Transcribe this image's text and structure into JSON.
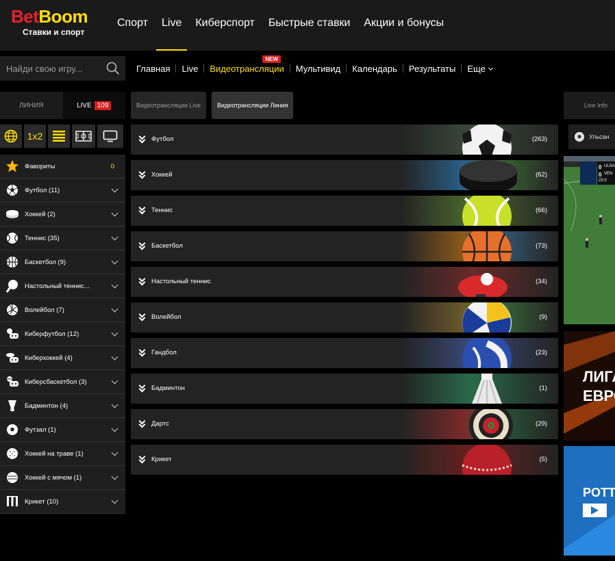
{
  "brand": {
    "name_part1": "Bet",
    "name_part2": "Boom",
    "tagline": "Ставки и спорт"
  },
  "main_nav": [
    {
      "label": "Спорт",
      "active": false
    },
    {
      "label": "Live",
      "active": true
    },
    {
      "label": "Киберспорт",
      "active": false
    },
    {
      "label": "Быстрые ставки",
      "active": false
    },
    {
      "label": "Акции и бонусы",
      "active": false
    }
  ],
  "search": {
    "placeholder": "Найди свою игру..."
  },
  "sub_nav": {
    "items": [
      "Главная",
      "Live",
      "Видеотрансляции",
      "Мультивид",
      "Календарь",
      "Результаты",
      "Еще"
    ],
    "highlighted": "Видеотрансляции",
    "new_badge": "NEW"
  },
  "left_tabs": {
    "line": "ЛИНИЯ",
    "live": "LIVE",
    "live_count": "109"
  },
  "filter_icons": [
    "globe-icon",
    "1x2",
    "list-icon",
    "field-icon",
    "monitor-icon"
  ],
  "favorites": {
    "label": "Фавориты",
    "count": "0"
  },
  "sports": [
    {
      "label": "Футбол (11)",
      "icon": "soccer-ball-icon"
    },
    {
      "label": "Хоккей (2)",
      "icon": "hockey-puck-icon"
    },
    {
      "label": "Теннис (35)",
      "icon": "tennis-ball-icon"
    },
    {
      "label": "Баскетбол (9)",
      "icon": "basketball-icon"
    },
    {
      "label": "Настольный теннис...",
      "icon": "table-tennis-icon"
    },
    {
      "label": "Волейбол (7)",
      "icon": "volleyball-icon"
    },
    {
      "label": "Киберфутбол (12)",
      "icon": "esports-soccer-icon"
    },
    {
      "label": "Киберхоккей (4)",
      "icon": "esports-hockey-icon"
    },
    {
      "label": "Киберсбаскетбол (3)",
      "icon": "esports-basketball-icon"
    },
    {
      "label": "Бадминтон (4)",
      "icon": "shuttlecock-icon"
    },
    {
      "label": "Футзал (1)",
      "icon": "futsal-ball-icon"
    },
    {
      "label": "Хоккей на траве (1)",
      "icon": "field-hockey-icon"
    },
    {
      "label": "Хоккей с мячом (1)",
      "icon": "bandy-ball-icon"
    },
    {
      "label": "Крикет (10)",
      "icon": "cricket-icon"
    }
  ],
  "video_tabs": {
    "live": "Видеотрансляции Live",
    "line": "Видеотрансляции Линия"
  },
  "categories": [
    {
      "name": "Футбол",
      "count": "(263)",
      "ball": "soccer-ball-icon",
      "paint": "#2a3a2a"
    },
    {
      "name": "Хоккей",
      "count": "(62)",
      "ball": "hockey-puck-icon",
      "paint": "#4a90c8"
    },
    {
      "name": "Теннис",
      "count": "(66)",
      "ball": "tennis-ball-icon",
      "paint": "#6b8f3a"
    },
    {
      "name": "Баскетбол",
      "count": "(73)",
      "ball": "basketball-icon",
      "paint": "#c87a2a"
    },
    {
      "name": "Настольный теннис",
      "count": "(34)",
      "ball": "table-tennis-icon",
      "paint": "#a04040"
    },
    {
      "name": "Волейбол",
      "count": "(9)",
      "ball": "volleyball-icon",
      "paint": "#8a7a30"
    },
    {
      "name": "Гандбол",
      "count": "(23)",
      "ball": "handball-icon",
      "paint": "#4f6fb0"
    },
    {
      "name": "Бадминтон",
      "count": "(1)",
      "ball": "shuttlecock-icon",
      "paint": "#3a8a5a"
    },
    {
      "name": "Дартс",
      "count": "(29)",
      "ball": "dartboard-icon",
      "paint": "#a03030"
    },
    {
      "name": "Крикет",
      "count": "(5)",
      "ball": "cricket-ball-icon",
      "paint": "#9a2a2a"
    }
  ],
  "right_panel": {
    "tab": "Live Info",
    "match_label": "Ульсан",
    "score_home": "0",
    "score_away": "0",
    "team_home": "ULSA",
    "team_away": "VEN",
    "clock": "22:0",
    "promo1_line1": "ЛИГА",
    "promo1_line2": "ЕВРО",
    "promo2": "POTTER"
  },
  "colors": {
    "accent": "#ffe000",
    "brand_red": "#e8202a",
    "badge_red": "#d81e1e"
  }
}
